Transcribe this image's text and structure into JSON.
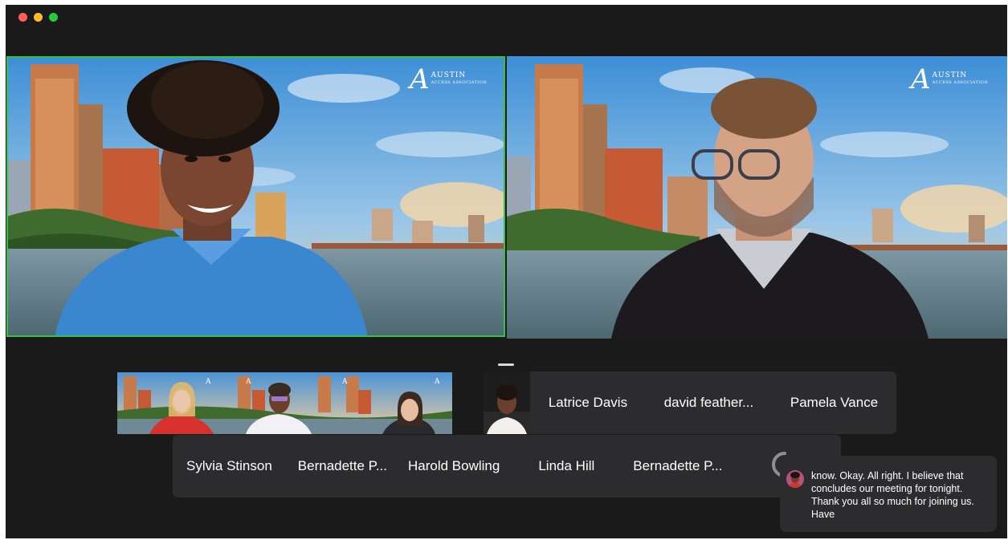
{
  "window": {
    "traffic_lights": {
      "close_color": "#ff5f57",
      "minimize_color": "#febc2e",
      "zoom_color": "#28c840"
    }
  },
  "main_tiles": [
    {
      "id": "speaker-left",
      "active": true,
      "active_border_color": "#31c24a"
    },
    {
      "id": "speaker-right",
      "active": false
    }
  ],
  "background_logo": {
    "main": "AUSTIN",
    "sub": "ACCESS ASSOCIATION"
  },
  "participant_names_row1": [
    "Latrice Davis",
    "david feather...",
    "Pamela Vance"
  ],
  "participant_names_row2": [
    "Sylvia Stinson",
    "Bernadette P...",
    "Harold Bowling",
    "Linda Hill",
    "Bernadette P..."
  ],
  "caption": {
    "text": "know. Okay. All right. I believe that concludes our meeting for tonight. Thank you all so much for joining us. Have"
  }
}
